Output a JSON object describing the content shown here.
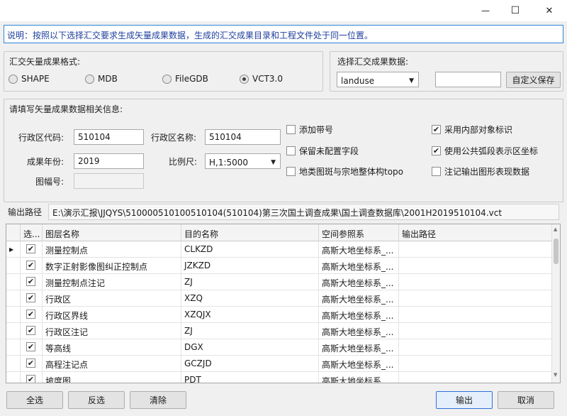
{
  "window": {
    "controls": {
      "minimize": "—",
      "maximize": "☐",
      "close": "✕"
    }
  },
  "note": "说明：按照以下选择汇交要求生成矢量成果数据，生成的汇交成果目录和工程文件处于同一位置。",
  "format_group": {
    "title": "汇交矢量成果格式:",
    "options": [
      {
        "label": "SHAPE",
        "checked": false
      },
      {
        "label": "MDB",
        "checked": false
      },
      {
        "label": "FileGDB",
        "checked": false
      },
      {
        "label": "VCT3.0",
        "checked": true
      }
    ]
  },
  "data_group": {
    "title": "选择汇交成果数据:",
    "combo_value": "landuse",
    "custom_value": "",
    "save_button": "自定义保存"
  },
  "info_group": {
    "title": "请填写矢量成果数据相关信息:",
    "admin_code_label": "行政区代码:",
    "admin_code_value": "510104",
    "admin_name_label": "行政区名称:",
    "admin_name_value": "510104",
    "year_label": "成果年份:",
    "year_value": "2019",
    "scale_label": "比例尺:",
    "scale_value": "H,1:5000",
    "map_no_label": "图幅号:",
    "map_no_value": "",
    "checkboxes": [
      {
        "label": "添加带号",
        "checked": false
      },
      {
        "label": "采用内部对象标识",
        "checked": true
      },
      {
        "label": "保留未配置字段",
        "checked": false
      },
      {
        "label": "使用公共弧段表示区坐标",
        "checked": true
      },
      {
        "label": "地类图斑与宗地整体构topo",
        "checked": false
      },
      {
        "label": "注记输出图形表现数据",
        "checked": false
      }
    ]
  },
  "output": {
    "label": "输出路径",
    "path": "E:\\演示汇报\\JJQYS\\510000510100510104(510104)第三次国土调查成果\\国土调查数据库\\2001H2019510104.vct"
  },
  "grid": {
    "columns": [
      "选...",
      "图层名称",
      "目的名称",
      "空间参照系",
      "输出路径"
    ],
    "current_row_marker": "▶",
    "rows": [
      {
        "checked": true,
        "layer": "测量控制点",
        "target": "CLKZD",
        "srs": "高斯大地坐标系_...",
        "out": ""
      },
      {
        "checked": true,
        "layer": "数字正射影像图纠正控制点",
        "target": "JZKZD",
        "srs": "高斯大地坐标系_...",
        "out": ""
      },
      {
        "checked": true,
        "layer": "测量控制点注记",
        "target": "ZJ",
        "srs": "高斯大地坐标系_...",
        "out": ""
      },
      {
        "checked": true,
        "layer": "行政区",
        "target": "XZQ",
        "srs": "高斯大地坐标系_...",
        "out": ""
      },
      {
        "checked": true,
        "layer": "行政区界线",
        "target": "XZQJX",
        "srs": "高斯大地坐标系_...",
        "out": ""
      },
      {
        "checked": true,
        "layer": "行政区注记",
        "target": "ZJ",
        "srs": "高斯大地坐标系_...",
        "out": ""
      },
      {
        "checked": true,
        "layer": "等高线",
        "target": "DGX",
        "srs": "高斯大地坐标系_...",
        "out": ""
      },
      {
        "checked": true,
        "layer": "高程注记点",
        "target": "GCZJD",
        "srs": "高斯大地坐标系_...",
        "out": ""
      },
      {
        "checked": true,
        "layer": "坡度图",
        "target": "PDT",
        "srs": "高斯大地坐标系",
        "out": ""
      }
    ]
  },
  "buttons": {
    "select_all": "全选",
    "invert": "反选",
    "clear": "清除",
    "export": "输出",
    "cancel": "取消"
  },
  "colors": {
    "note_text": "#1f3e9c",
    "note_border": "#2f86d6",
    "primary_border": "#2f6fd6"
  }
}
